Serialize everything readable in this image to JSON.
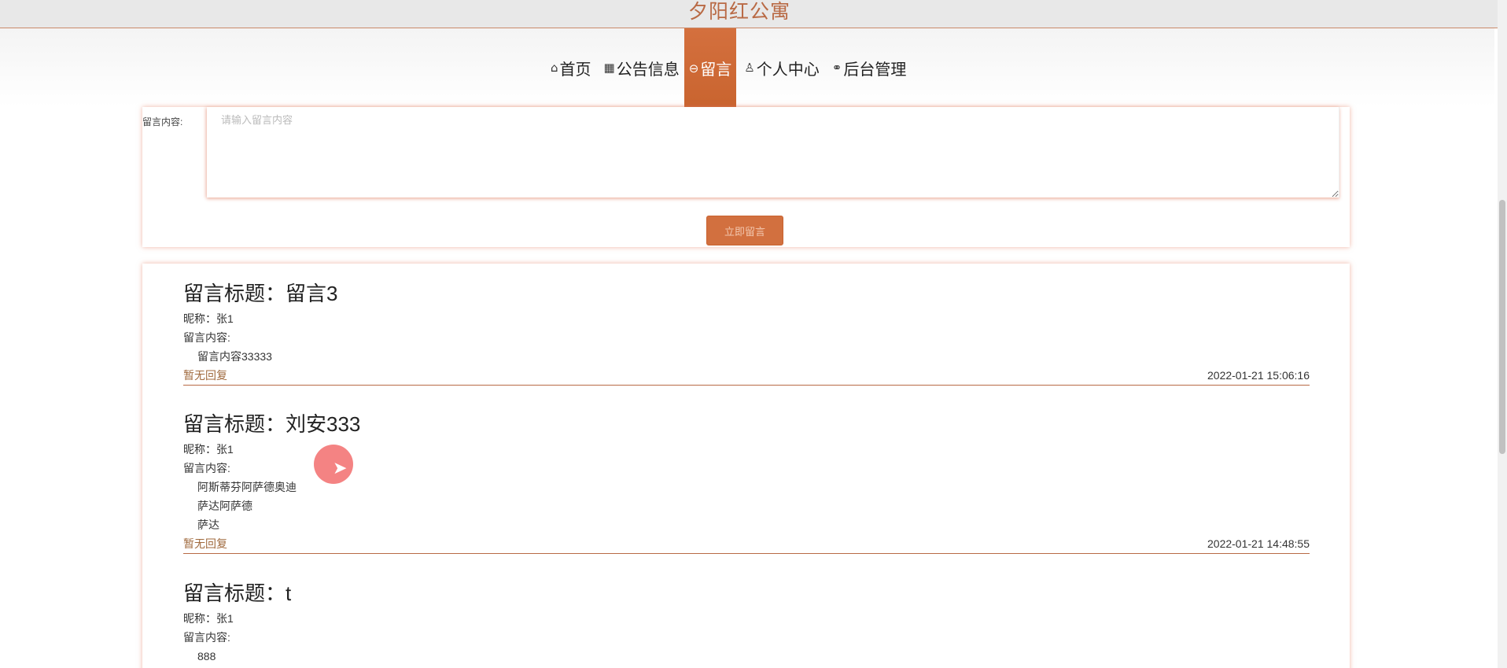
{
  "site": {
    "title": "夕阳红公寓"
  },
  "nav": {
    "items": [
      {
        "icon": "home-icon",
        "label": "首页"
      },
      {
        "icon": "grid-icon",
        "label": "公告信息"
      },
      {
        "icon": "message-icon",
        "label": "留言"
      },
      {
        "icon": "user-icon",
        "label": "个人中心"
      },
      {
        "icon": "link-icon",
        "label": "后台管理"
      }
    ],
    "active_index": 2
  },
  "form": {
    "content_label": "留言内容:",
    "content_placeholder": "请输入留言内容",
    "submit_label": "立即留言"
  },
  "messages": [
    {
      "title": "留言标题：留言3",
      "nick": "昵称：张1",
      "content_label": "留言内容:",
      "lines": [
        "留言内容33333"
      ],
      "reply": "暂无回复",
      "time": "2022-01-21 15:06:16"
    },
    {
      "title": "留言标题：刘安333",
      "nick": "昵称：张1",
      "content_label": "留言内容:",
      "lines": [
        "阿斯蒂芬阿萨德奥迪",
        "萨达阿萨德",
        "萨达"
      ],
      "reply": "暂无回复",
      "time": "2022-01-21 14:48:55"
    },
    {
      "title": "留言标题：t",
      "nick": "昵称：张1",
      "content_label": "留言内容:",
      "lines": [
        "888"
      ],
      "reply": "",
      "time": ""
    }
  ],
  "colors": {
    "accent": "#d2703f",
    "title_text": "#b96a45",
    "reply_text": "#a06a3e"
  }
}
